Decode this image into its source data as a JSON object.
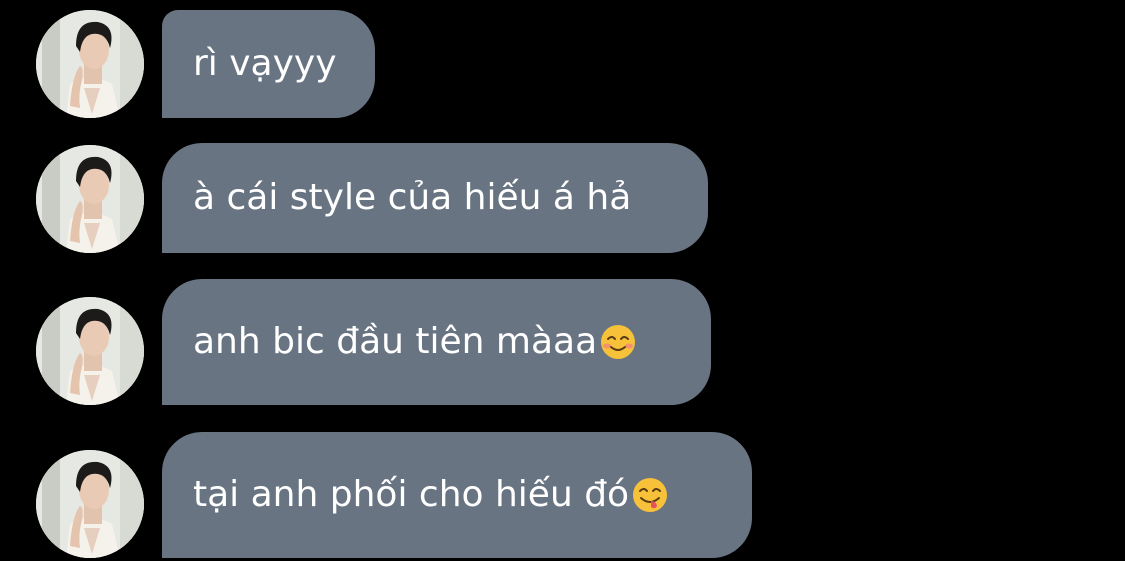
{
  "conversation": {
    "background_color": "#000000",
    "bubble_color": "#687482",
    "text_color": "#ffffff",
    "messages": [
      {
        "text": "rì vạyyy",
        "emoji": null
      },
      {
        "text": "à cái style của hiếu á hả",
        "emoji": null
      },
      {
        "text": "anh bic đầu tiên màaa",
        "emoji": "smiling-face-icon"
      },
      {
        "text": "tại anh phối cho hiếu đó",
        "emoji": "face-savoring-food-icon"
      }
    ]
  }
}
